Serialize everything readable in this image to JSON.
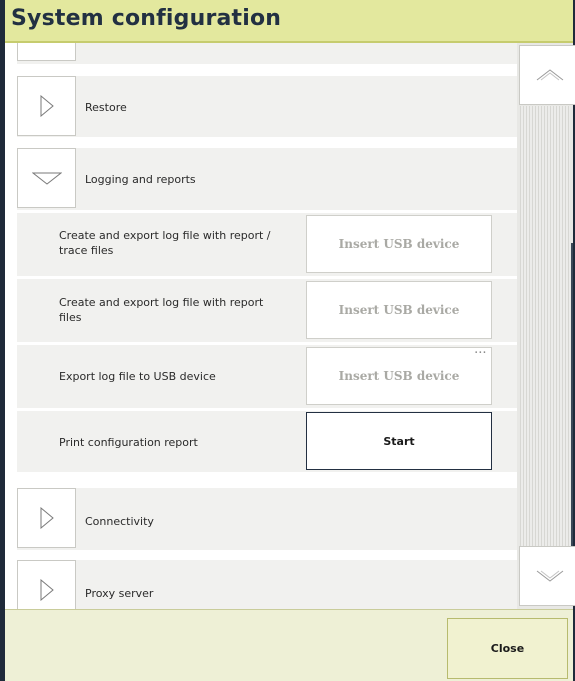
{
  "window": {
    "title": "System configuration"
  },
  "sections": {
    "restore": {
      "label": "Restore",
      "state": "collapsed"
    },
    "logging": {
      "label": "Logging and reports",
      "state": "expanded"
    },
    "connectivity": {
      "label": "Connectivity",
      "state": "collapsed"
    },
    "proxy": {
      "label": "Proxy server",
      "state": "collapsed"
    }
  },
  "logging_items": [
    {
      "label": "Create and export log file with report / trace files",
      "action": "Insert USB device",
      "enabled": false
    },
    {
      "label": "Create and export log file with report files",
      "action": "Insert USB device",
      "enabled": false
    },
    {
      "label": "Export log file to USB device",
      "action": "Insert USB device",
      "enabled": false,
      "more_indicator": "..."
    },
    {
      "label": "Print configuration report",
      "action": "Start",
      "enabled": true
    }
  ],
  "footer": {
    "close_label": "Close"
  },
  "icons": {
    "expand": "chevron-right-icon",
    "collapse": "chevron-down-icon",
    "scroll_up": "scroll-up-icon",
    "scroll_down": "scroll-down-icon"
  },
  "colors": {
    "title_bar": "#e3e89e",
    "title_text": "#223042",
    "footer": "#eef0d6",
    "disabled_text": "#a9a9a4",
    "frame": "#1f2a3a"
  }
}
